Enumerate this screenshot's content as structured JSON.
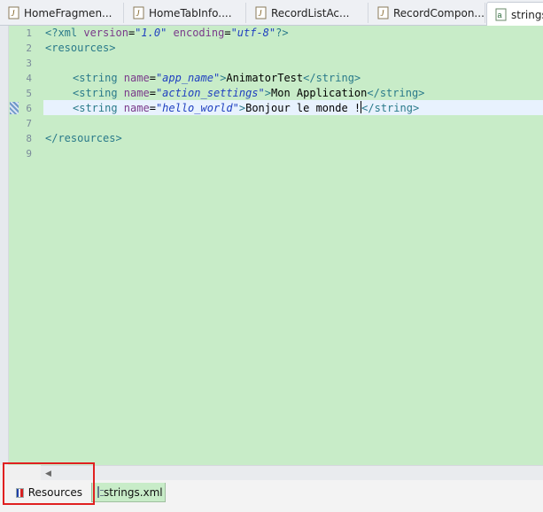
{
  "tabs": [
    {
      "label": "HomeFragmen...",
      "icon": "java-file-icon"
    },
    {
      "label": "HomeTabInfo....",
      "icon": "java-file-icon"
    },
    {
      "label": "RecordListAc...",
      "icon": "java-file-icon"
    },
    {
      "label": "RecordCompon...",
      "icon": "java-file-icon"
    },
    {
      "label": "strings.x",
      "icon": "xml-file-icon",
      "active": true
    }
  ],
  "editor": {
    "line_numbers": [
      "1",
      "2",
      "3",
      "4",
      "5",
      "6",
      "7",
      "8",
      "9"
    ],
    "current_line": "6",
    "background": "#c8ecc8",
    "lines": {
      "l1": {
        "open": "<?xml ",
        "a1": "version",
        "eq1": "=",
        "v1": "\"1.0\"",
        "a2": " encoding",
        "eq2": "=",
        "v2": "\"utf-8\"",
        "close": "?>"
      },
      "l2": {
        "tag": "<resources>"
      },
      "l4": {
        "open": "<string ",
        "attr": "name",
        "eq": "=",
        "val": "\"app_name\"",
        "close": ">",
        "text": "AnimatorTest",
        "end": "</string>"
      },
      "l5": {
        "open": "<string ",
        "attr": "name",
        "eq": "=",
        "val": "\"action_settings\"",
        "close": ">",
        "text": "Mon Application",
        "end": "</string>"
      },
      "l6": {
        "open": "<string ",
        "attr": "name",
        "eq": "=",
        "val": "\"hello_world\"",
        "close": ">",
        "text": "Bonjour le monde !",
        "end": "</string>"
      },
      "l8": {
        "tag": "</resources>"
      }
    }
  },
  "bottom_tabs": {
    "resources_label": "Resources",
    "strings_label": "strings.xml"
  },
  "colors": {
    "highlight_box": "#e02020",
    "tag": "#2a7a8a",
    "attr": "#7a3a8a",
    "value": "#2040c0"
  }
}
